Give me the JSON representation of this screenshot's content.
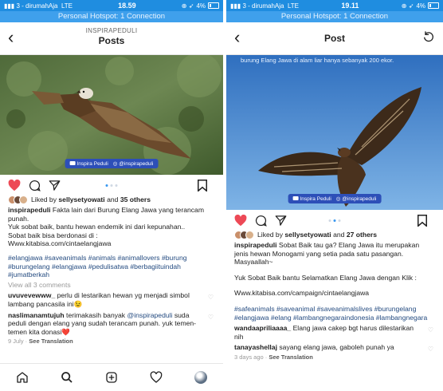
{
  "left": {
    "status": {
      "carrier": "3 - dirumahAja",
      "network": "LTE",
      "time": "18.59",
      "battery": "4%"
    },
    "hotspot": "Personal Hotspot: 1 Connection",
    "nav": {
      "subtitle": "INSPIRAPEDULI",
      "title": "Posts"
    },
    "badge": {
      "name": "Inspira Peduli",
      "handle": "@inspirapeduli"
    },
    "post": {
      "liked_prefix": "Liked by ",
      "liked_user": "sellysetyowati",
      "liked_mid": " and ",
      "liked_count": "35 others",
      "author": "inspirapeduli",
      "caption_1": " Fakta lain dari Burung Elang Jawa yang terancam punah.",
      "caption_2": "Yuk sobat baik, bantu hewan endemik ini dari kepunahan..",
      "caption_3": "Sobat baik bisa berdonasi di :",
      "caption_4": "Www.kitabisa.com/cintaelangjawa",
      "hashtags": "#elangjawa #saveanimals #animals #animallovers #burung #burungelang #elangjawa #pedulisatwa #berbagiituindah #jumatberkah",
      "view_comments": "View all 3 comments",
      "comments": [
        {
          "user": "uvuvevewww_",
          "text": " perlu di lestarikan hewan yg menjadi simbol lambang pancasila ini😉"
        },
        {
          "user": "naslimanamtujuh",
          "text": " terimakasih banyak ",
          "mention": "@inspirapeduli",
          "text2": " suda peduli dengan elang yang sudah terancam punah. yuk temen-temen kita donasi❤️"
        }
      ],
      "date": "9 July",
      "see_translation": "See Translation"
    }
  },
  "right": {
    "status": {
      "carrier": "3 - dirumahAja",
      "network": "LTE",
      "time": "19.11",
      "battery": "4%"
    },
    "hotspot": "Personal Hotspot: 1 Connection",
    "nav": {
      "title": "Post"
    },
    "photo_caption": "burung Elang Jawa di alam liar hanya sebanyak 200 ekor.",
    "badge": {
      "name": "Inspira Peduli",
      "handle": "@inspirapeduli"
    },
    "post": {
      "liked_prefix": "Liked by ",
      "liked_user": "sellysetyowati",
      "liked_mid": " and ",
      "liked_count": "27 others",
      "author": "inspirapeduli",
      "caption_1": " Sobat Baik tau ga? Elang Jawa itu merupakan jenis hewan Monogami yang setia pada satu pasangan. Masyaallah~",
      "caption_2": "Yuk Sobat Baik bantu Selamatkan Elang Jawa dengan Klik :",
      "caption_3": "Www.kitabisa.com/campaign/cintaelangjawa",
      "hashtags": "#safeanimals #saveanimal #saveanimalslives #burungelang #elangjawa #elang #lambangnegaraindonesia #lambangnegara",
      "comments": [
        {
          "user": "wandaapriliaaaa_",
          "text": " Elang jawa cakep bgt harus dilestarikan nih"
        },
        {
          "user": "tanayashellaj",
          "text": " sayang elang jawa, gaboleh punah ya"
        }
      ],
      "date": "3 days ago",
      "see_translation": "See Translation"
    }
  },
  "colors": {
    "statusbar": "#1f8de0",
    "hotspot": "#3fa0ec",
    "heart": "#ed4956",
    "hashtag": "#244b80"
  }
}
